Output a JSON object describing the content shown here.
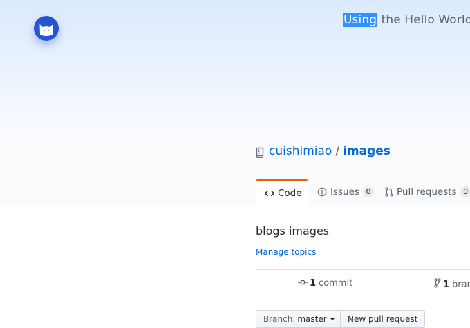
{
  "banner": {
    "highlighted": "Using",
    "rest": " the Hello World g"
  },
  "repo": {
    "owner": "cuishimiao",
    "separator": "/",
    "name": "images"
  },
  "tabs": [
    {
      "label": "Code"
    },
    {
      "label": "Issues",
      "count": "0"
    },
    {
      "label": "Pull requests",
      "count": "0"
    }
  ],
  "description": "blogs images",
  "manage_topics": "Manage topics",
  "summary": {
    "commits_count": "1",
    "commits_label": "commit",
    "branches_count": "1",
    "branches_label": "bran"
  },
  "buttons": {
    "branch_prefix": "Branch:",
    "branch_value": "master",
    "new_pr": "New pull request"
  },
  "colors": {
    "accent": "#0366d6",
    "tab_highlight": "#e36209",
    "avatar": "#2554d4",
    "selection": "#3390ff"
  }
}
